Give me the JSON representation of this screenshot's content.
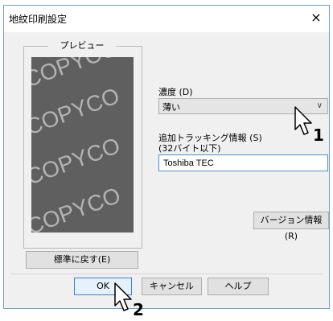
{
  "window": {
    "title": "地紋印刷設定",
    "close_symbol": "×"
  },
  "preview": {
    "label": "プレビュー",
    "watermark_text": "COPYCO",
    "reset_button": "標準に戻す(E)"
  },
  "density": {
    "label": "濃度 (D)",
    "selected_value": "薄い"
  },
  "tracking": {
    "label_line1": "追加トラッキング情報 (S)",
    "label_line2": "(32バイト以下)",
    "value": "Toshiba TEC"
  },
  "version_button": "バージョン情報(R)",
  "footer": {
    "ok": "OK",
    "cancel": "キャンセル",
    "help": "ヘルプ"
  },
  "callouts": {
    "one": "1",
    "two": "2"
  },
  "colors": {
    "preview_bg": "#5f5f5f",
    "watermark": "#b3b3b3",
    "accent": "#3c7fd6"
  }
}
